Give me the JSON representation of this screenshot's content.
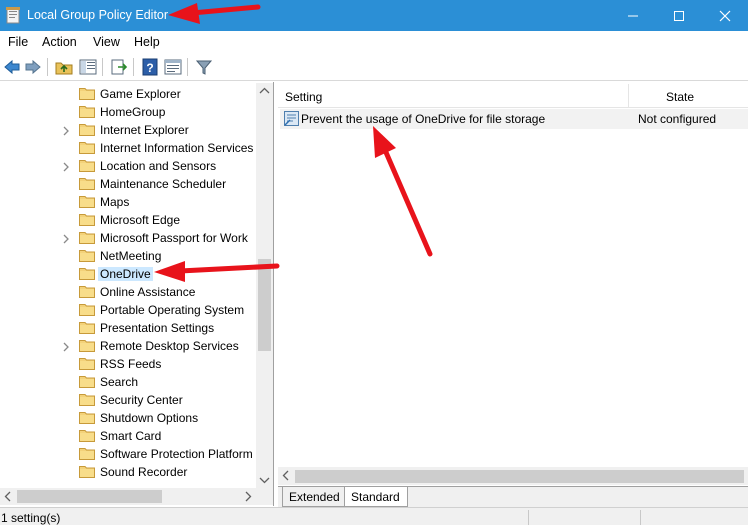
{
  "window": {
    "title": "Local Group Policy Editor"
  },
  "menu": [
    "File",
    "Action",
    "View",
    "Help"
  ],
  "tree": [
    {
      "label": "Game Explorer",
      "expandable": false
    },
    {
      "label": "HomeGroup",
      "expandable": false
    },
    {
      "label": "Internet Explorer",
      "expandable": true
    },
    {
      "label": "Internet Information Services",
      "expandable": false
    },
    {
      "label": "Location and Sensors",
      "expandable": true
    },
    {
      "label": "Maintenance Scheduler",
      "expandable": false
    },
    {
      "label": "Maps",
      "expandable": false
    },
    {
      "label": "Microsoft Edge",
      "expandable": false
    },
    {
      "label": "Microsoft Passport for Work",
      "expandable": true
    },
    {
      "label": "NetMeeting",
      "expandable": false
    },
    {
      "label": "OneDrive",
      "expandable": false,
      "selected": true
    },
    {
      "label": "Online Assistance",
      "expandable": false
    },
    {
      "label": "Portable Operating System",
      "expandable": false
    },
    {
      "label": "Presentation Settings",
      "expandable": false
    },
    {
      "label": "Remote Desktop Services",
      "expandable": true
    },
    {
      "label": "RSS Feeds",
      "expandable": false
    },
    {
      "label": "Search",
      "expandable": false
    },
    {
      "label": "Security Center",
      "expandable": false
    },
    {
      "label": "Shutdown Options",
      "expandable": false
    },
    {
      "label": "Smart Card",
      "expandable": false
    },
    {
      "label": "Software Protection Platform",
      "expandable": false
    },
    {
      "label": "Sound Recorder",
      "expandable": false
    }
  ],
  "list": {
    "columns": {
      "setting": "Setting",
      "state": "State"
    },
    "rows": [
      {
        "setting": "Prevent the usage of OneDrive for file storage",
        "state": "Not configured"
      }
    ]
  },
  "tabs": [
    "Extended",
    "Standard"
  ],
  "active_tab": "Standard",
  "status": {
    "text": "1 setting(s)"
  },
  "colors": {
    "titlebar": "#2b8fd6",
    "selection": "#cce8ff",
    "annotation_arrow": "#e8131b"
  }
}
